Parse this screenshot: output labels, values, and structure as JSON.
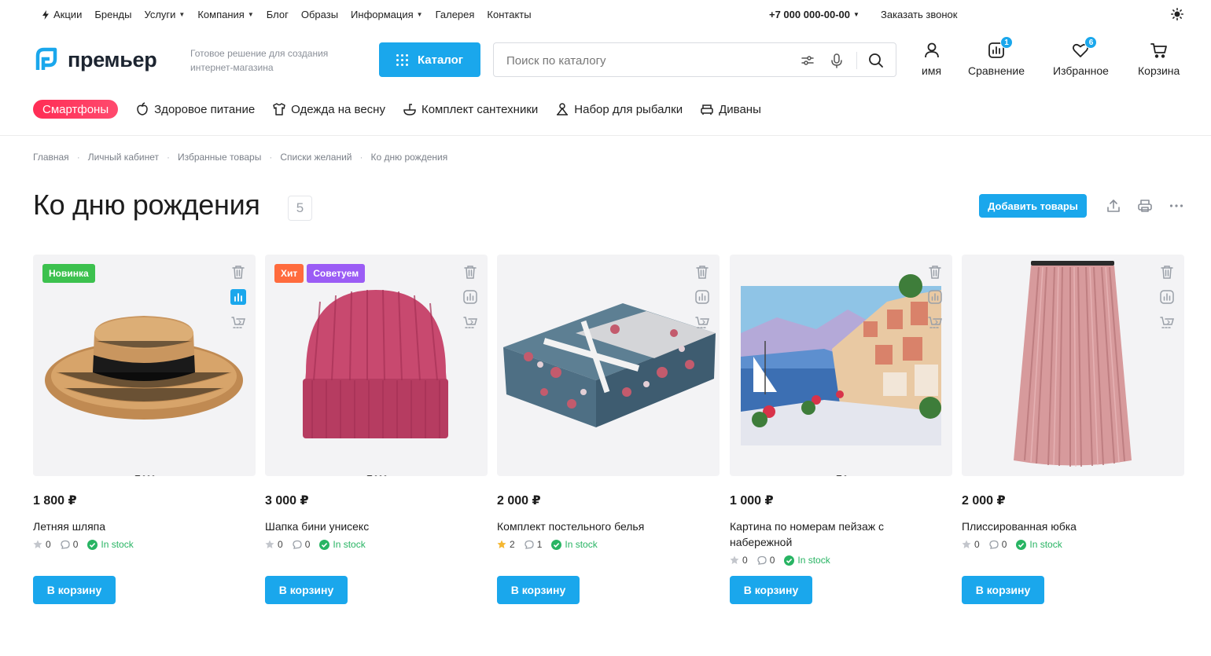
{
  "topbar": {
    "nav": [
      {
        "label": "Акции",
        "icon": "bolt-icon"
      },
      {
        "label": "Бренды"
      },
      {
        "label": "Услуги",
        "dropdown": true
      },
      {
        "label": "Компания",
        "dropdown": true
      },
      {
        "label": "Блог"
      },
      {
        "label": "Образы"
      },
      {
        "label": "Информация",
        "dropdown": true
      },
      {
        "label": "Галерея"
      },
      {
        "label": "Контакты"
      }
    ],
    "phone": "+7 000 000-00-00",
    "callback": "Заказать звонок"
  },
  "header": {
    "logo_text": "премьер",
    "tagline": "Готовое решение для создания интернет-магазина",
    "catalog_label": "Каталог",
    "search_placeholder": "Поиск по каталогу",
    "account_label": "имя",
    "compare_label": "Сравнение",
    "compare_count": "1",
    "favorites_label": "Избранное",
    "favorites_count": "6",
    "cart_label": "Корзина"
  },
  "categories": [
    {
      "label": "Смартфоны",
      "highlight": true
    },
    {
      "label": "Здоровое питание",
      "icon": "apple-icon"
    },
    {
      "label": "Одежда на весну",
      "icon": "shirt-icon"
    },
    {
      "label": "Комплект сантехники",
      "icon": "sink-icon"
    },
    {
      "label": "Набор для рыбалки",
      "icon": "fishing-icon"
    },
    {
      "label": "Диваны",
      "icon": "sofa-icon"
    }
  ],
  "breadcrumbs": [
    "Главная",
    "Личный кабинет",
    "Избранные товары",
    "Списки желаний",
    "Ко дню рождения"
  ],
  "page": {
    "title": "Ко дню рождения",
    "count": "5",
    "add_button": "Добавить товары"
  },
  "products": [
    {
      "price": "1 800 ₽",
      "name": "Летняя шляпа",
      "rating": "0",
      "reviews": "0",
      "stock": "In stock",
      "cart": "В корзину",
      "labels": [
        {
          "text": "Новинка",
          "color": "#3cc14e"
        }
      ],
      "compare_active": true,
      "image": "straw-hat",
      "star_color": "#c3c6cc"
    },
    {
      "price": "3 000 ₽",
      "name": "Шапка бини унисекс",
      "rating": "0",
      "reviews": "0",
      "stock": "In stock",
      "cart": "В корзину",
      "labels": [
        {
          "text": "Хит",
          "color": "#ff6b3d"
        },
        {
          "text": "Советуем",
          "color": "#9b5cf5"
        }
      ],
      "compare_active": false,
      "image": "beanie",
      "star_color": "#c3c6cc"
    },
    {
      "price": "2 000 ₽",
      "name": "Комплект постельного белья",
      "rating": "2",
      "reviews": "1",
      "stock": "In stock",
      "cart": "В корзину",
      "labels": [],
      "compare_active": false,
      "image": "bedding-set",
      "star_color": "#f5b731"
    },
    {
      "price": "1 000 ₽",
      "name": "Картина по номерам пейзаж с набережной",
      "rating": "0",
      "reviews": "0",
      "stock": "In stock",
      "cart": "В корзину",
      "labels": [],
      "compare_active": false,
      "image": "painting",
      "star_color": "#c3c6cc"
    },
    {
      "price": "2 000 ₽",
      "name": "Плиссированная юбка",
      "rating": "0",
      "reviews": "0",
      "stock": "In stock",
      "cart": "В корзину",
      "labels": [],
      "compare_active": false,
      "image": "pleated-skirt",
      "star_color": "#c3c6cc"
    }
  ],
  "colors": {
    "accent": "#1aa7ec",
    "stock": "#28b463",
    "pill": "#ff2d55"
  }
}
